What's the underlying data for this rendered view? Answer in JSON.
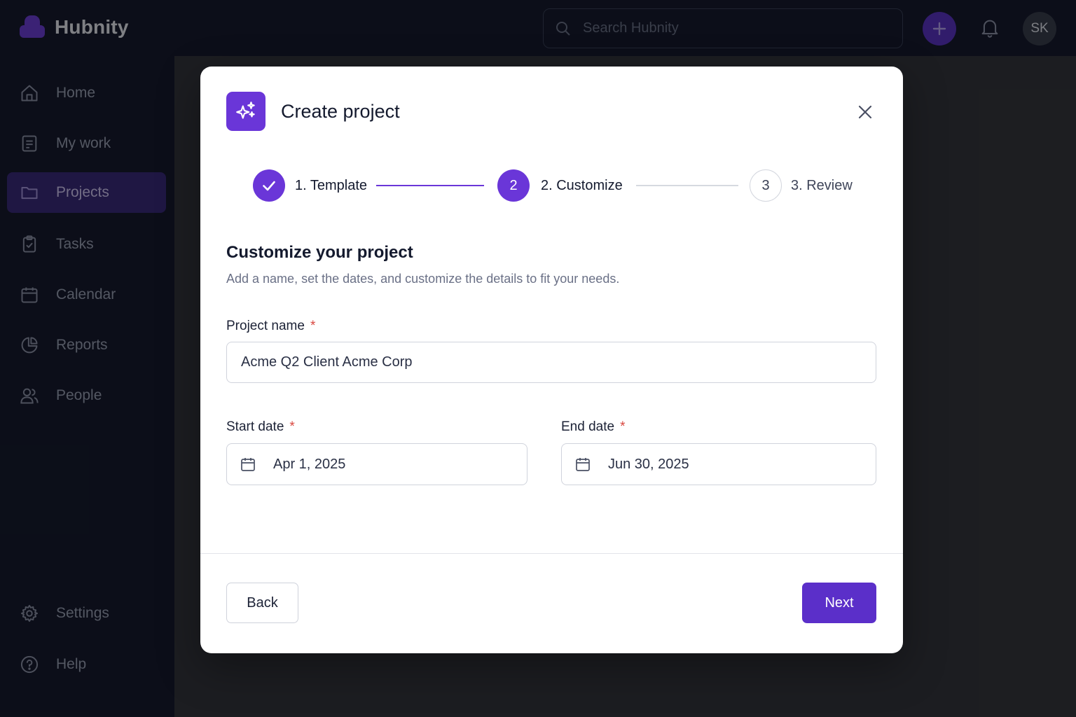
{
  "app": {
    "name": "Hubnity"
  },
  "header": {
    "search_placeholder": "Search Hubnity",
    "avatar_initials": "SK"
  },
  "sidebar": {
    "items": [
      {
        "label": "Home",
        "icon": "home-icon",
        "active": false
      },
      {
        "label": "My work",
        "icon": "checklist-icon",
        "active": false
      },
      {
        "label": "Projects",
        "icon": "folder-icon",
        "active": true
      },
      {
        "label": "Tasks",
        "icon": "clipboard-check-icon",
        "active": false
      },
      {
        "label": "Calendar",
        "icon": "calendar-icon",
        "active": false
      },
      {
        "label": "Reports",
        "icon": "pie-chart-icon",
        "active": false
      },
      {
        "label": "People",
        "icon": "people-icon",
        "active": false
      }
    ],
    "bottom_items": [
      {
        "label": "Settings",
        "icon": "gear-icon"
      },
      {
        "label": "Help",
        "icon": "help-icon"
      }
    ]
  },
  "modal": {
    "title": "Create project",
    "icon": "sparkles-icon",
    "steps": [
      {
        "number": "1",
        "label": "1. Template",
        "state": "done"
      },
      {
        "number": "2",
        "label": "2. Customize",
        "state": "current"
      },
      {
        "number": "3",
        "label": "3. Review",
        "state": "todo"
      }
    ],
    "section_title": "Customize your project",
    "section_desc": "Add a name, set the dates, and customize the details to fit your needs.",
    "fields": {
      "project_name": {
        "label": "Project name",
        "required_mark": "*",
        "value": "Acme Q2 Client Acme Corp"
      },
      "start_date": {
        "label": "Start date",
        "required_mark": "*",
        "value": "Apr 1, 2025"
      },
      "end_date": {
        "label": "End date",
        "required_mark": "*",
        "value": "Jun 30, 2025"
      }
    },
    "back_label": "Back",
    "next_label": "Next"
  },
  "colors": {
    "accent": "#6a36d8",
    "primary_button": "#5b2fc9",
    "required": "#d9473f"
  }
}
